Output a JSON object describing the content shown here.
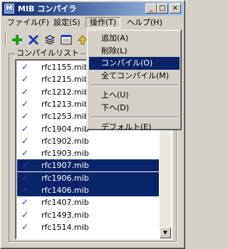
{
  "window": {
    "title": "MIB コンパイラ",
    "minimize": "_",
    "maximize": "□",
    "close": "×"
  },
  "menubar": {
    "items": [
      "ファイル(F)",
      "設定(S)",
      "操作(T)",
      "ヘルプ(H)"
    ],
    "open_menu": "操作(T)"
  },
  "toolbar": {
    "buttons": [
      "plus-icon",
      "delete-x-icon",
      "compile-stack-icon",
      "compile-all-icon",
      "up-icon"
    ],
    "colors": {
      "plus": "#1a9e1a",
      "delete": "#1a3fb0"
    }
  },
  "compile_list": {
    "label": "コンパイルリスト",
    "items": [
      {
        "name": "rfc1155.mib",
        "checked": true,
        "selected": false
      },
      {
        "name": "rfc1215.mib",
        "checked": true,
        "selected": false
      },
      {
        "name": "rfc1212.mib",
        "checked": true,
        "selected": false
      },
      {
        "name": "rfc1213.mib",
        "checked": true,
        "selected": false
      },
      {
        "name": "rfc1253.mib",
        "checked": true,
        "selected": false
      },
      {
        "name": "rfc1904.mib",
        "checked": true,
        "selected": false
      },
      {
        "name": "rfc1902.mib",
        "checked": true,
        "selected": false
      },
      {
        "name": "rfc1903.mib",
        "checked": true,
        "selected": false
      },
      {
        "name": "rfc1907.mib",
        "checked": true,
        "selected": true
      },
      {
        "name": "rfc1906.mib",
        "checked": true,
        "selected": true
      },
      {
        "name": "rfc1406.mib",
        "checked": true,
        "selected": true
      },
      {
        "name": "rfc1407.mib",
        "checked": true,
        "selected": false
      },
      {
        "name": "rfc1493.mib",
        "checked": true,
        "selected": false
      },
      {
        "name": "rfc1514.mib",
        "checked": true,
        "selected": false
      }
    ],
    "check_glyph": "✓"
  },
  "dropdown": {
    "groups": [
      [
        "追加(A)",
        "削除(L)",
        "コンパイル(O)",
        "全てコンパイル(M)"
      ],
      [
        "上へ(U)",
        "下へ(D)"
      ],
      [
        "デフォルト(E)"
      ]
    ],
    "highlighted": "コンパイル(O)"
  },
  "scrollbar": {
    "up": "▲",
    "down": "▼"
  }
}
